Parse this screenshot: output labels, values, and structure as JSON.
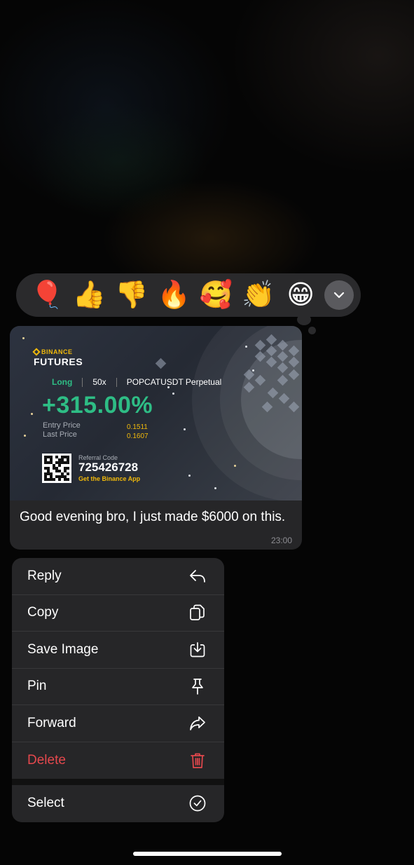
{
  "reactions": [
    {
      "emoji": "🎈",
      "name": "red-balloon"
    },
    {
      "emoji": "👍",
      "name": "thumbs-up"
    },
    {
      "emoji": "👎",
      "name": "thumbs-down"
    },
    {
      "emoji": "🔥",
      "name": "fire"
    },
    {
      "emoji": "🥰",
      "name": "smiling-hearts"
    },
    {
      "emoji": "👏",
      "name": "clapping"
    },
    {
      "emoji": "😁",
      "name": "grinning"
    }
  ],
  "more_reactions_icon": "chevron-down-icon",
  "card": {
    "brand_top": "BINANCE",
    "brand_main": "FUTURES",
    "side": "Long",
    "leverage": "50x",
    "pair": "POPCATUSDT Perpetual",
    "pnl": "+315.00%",
    "entry_label": "Entry Price",
    "last_label": "Last Price",
    "entry_price": "0.1511",
    "last_price": "0.1607",
    "referral_label": "Referral Code",
    "referral_code": "725426728",
    "app_cta": "Get the Binance App",
    "accent_green": "#2ebd85",
    "accent_yellow": "#f0b90b"
  },
  "message": {
    "text": "Good evening bro, I just made $6000 on this.",
    "time": "23:00"
  },
  "menu": {
    "reply": "Reply",
    "copy": "Copy",
    "save_image": "Save Image",
    "pin": "Pin",
    "forward": "Forward",
    "delete": "Delete",
    "select": "Select",
    "delete_color": "#e5484d"
  }
}
